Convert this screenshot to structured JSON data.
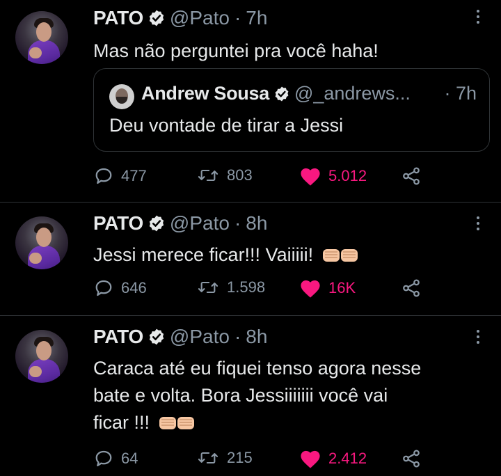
{
  "tweets": [
    {
      "author_name": "PATO",
      "handle": "@Pato",
      "separator": "·",
      "time": "7h",
      "text": "Mas não perguntei pra você haha!",
      "quote": {
        "author_name": "Andrew Sousa",
        "handle": "@_andrews...",
        "separator": "·",
        "time": "7h",
        "text": "Deu vontade de tirar a Jessi"
      },
      "replies": "477",
      "retweets": "803",
      "likes": "5.012"
    },
    {
      "author_name": "PATO",
      "handle": "@Pato",
      "separator": "·",
      "time": "8h",
      "text": "Jessi merece ficar!!! Vaiiiii!",
      "replies": "646",
      "retweets": "1.598",
      "likes": "16K"
    },
    {
      "author_name": "PATO",
      "handle": "@Pato",
      "separator": "·",
      "time": "8h",
      "text_line1": "Caraca até eu fiquei tenso agora nesse",
      "text_line2": "bate e volta. Bora Jessiiiiiii você vai",
      "text_line3": "ficar !!!",
      "replies": "64",
      "retweets": "215",
      "likes": "2.412"
    }
  ],
  "icons": {
    "reply": "speech-bubble-icon",
    "retweet": "retweet-icon",
    "like": "heart-icon",
    "share": "share-icon",
    "verified": "verified-badge-icon",
    "more": "more-vertical-icon",
    "emoji": "fist-bump-emoji"
  },
  "colors": {
    "background": "#000000",
    "text": "#e7e9ea",
    "secondary": "#8b98a5",
    "like": "#f91880",
    "divider": "#2f3336"
  }
}
